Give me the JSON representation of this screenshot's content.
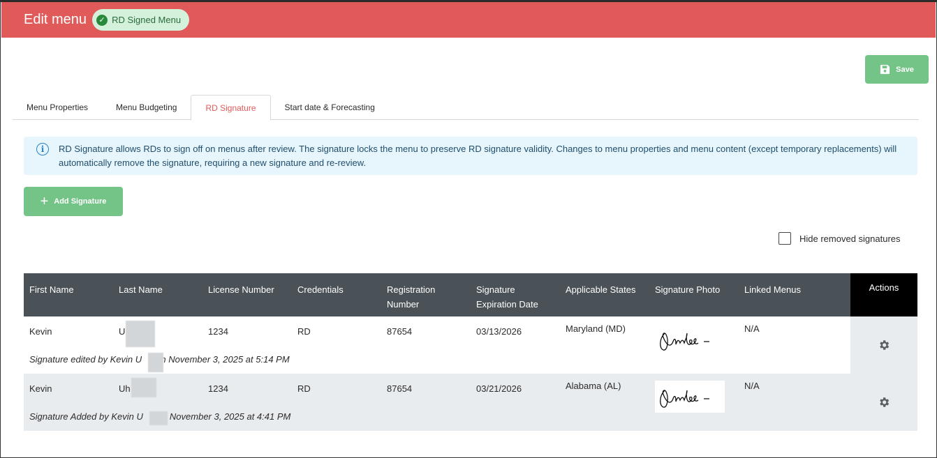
{
  "header": {
    "title": "Edit menu",
    "badge": "RD Signed Menu",
    "badge_icon": "check-circle-icon"
  },
  "toolbar": {
    "save_label": "Save",
    "save_icon": "floppy-disk-icon"
  },
  "tabs": [
    {
      "label": "Menu Properties",
      "active": false
    },
    {
      "label": "Menu Budgeting",
      "active": false
    },
    {
      "label": "RD Signature",
      "active": true
    },
    {
      "label": "Start date & Forecasting",
      "active": false
    }
  ],
  "info": {
    "icon": "info-icon",
    "text": "RD Signature allows RDs to sign off on menus after review. The signature locks the menu to preserve RD signature validity. Changes to menu properties and menu content (except temporary replacements) will automatically remove the signature, requiring a new signature and re-review."
  },
  "add_signature": {
    "label": "Add Signature",
    "icon": "plus-icon"
  },
  "hide_removed": {
    "label": "Hide removed signatures",
    "checked": false
  },
  "table": {
    "headers": {
      "first_name": "First Name",
      "last_name": "Last Name",
      "license_number": "License Number",
      "credentials": "Credentials",
      "registration_number_1": "Registration",
      "registration_number_2": "Number",
      "signature_expiration_1": "Signature",
      "signature_expiration_2": "Expiration Date",
      "applicable_states": "Applicable States",
      "signature_photo": "Signature Photo",
      "linked_menus": "Linked Menus",
      "actions": "Actions"
    },
    "rows": [
      {
        "first_name": "Kevin",
        "last_name": "U",
        "license_number": "1234",
        "credentials": "RD",
        "registration_number": "87654",
        "expiration": "03/13/2026",
        "state": "Maryland (MD)",
        "linked_menus": "N/A",
        "note_prefix": "Signature edited by Kevin U",
        "note_suffix": "on November 3, 2025 at 5:14 PM"
      },
      {
        "first_name": "Kevin",
        "last_name": "Uh",
        "license_number": "1234",
        "credentials": "RD",
        "registration_number": "87654",
        "expiration": "03/21/2026",
        "state": "Alabama (AL)",
        "linked_menus": "N/A",
        "note_prefix": "Signature Added by Kevin U",
        "note_suffix": "on November 3, 2025 at 4:41 PM"
      }
    ]
  },
  "colors": {
    "header_red": "#e05a5a",
    "green_button": "#74c487",
    "table_header": "#4a5257",
    "info_bg": "#e7f5fd"
  }
}
